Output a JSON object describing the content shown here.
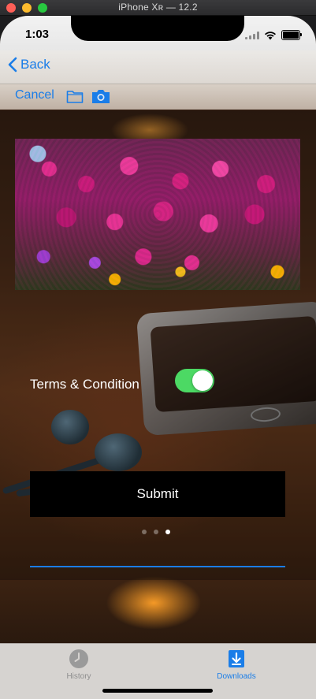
{
  "window": {
    "title": "iPhone Xʀ — 12.2"
  },
  "status_bar": {
    "time": "1:03",
    "icons": [
      "signal-icon",
      "wifi-icon",
      "battery-icon"
    ]
  },
  "nav": {
    "back_label": "Back",
    "back_icon": "chevron-left-icon"
  },
  "toolbar": {
    "cancel_label": "Cancel",
    "folder_icon": "folder-icon",
    "camera_icon": "camera-icon"
  },
  "form": {
    "terms_label": "Terms & Condition",
    "terms_toggle_on": true,
    "submit_label": "Submit",
    "page_count": 3,
    "page_current": 3,
    "text_field_value": ""
  },
  "tabs": [
    {
      "label": "History",
      "icon": "clock-icon",
      "selected": false
    },
    {
      "label": "Downloads",
      "icon": "download-icon",
      "selected": true
    }
  ],
  "colors": {
    "accent": "#1a7de8",
    "toggle_on": "#4cd964",
    "button_bg": "#000000"
  }
}
